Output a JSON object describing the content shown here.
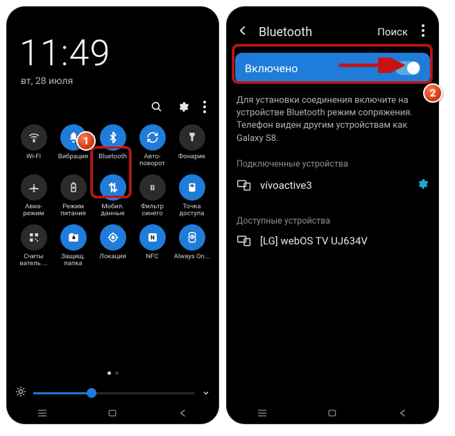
{
  "annotation": {
    "badge1": "1",
    "badge2": "2"
  },
  "phone1": {
    "clock": "11:49",
    "date": "вт, 28 июля",
    "tiles": [
      {
        "id": "wifi",
        "label": "Wi-Fi",
        "state": "off"
      },
      {
        "id": "vibration",
        "label": "Вибрация",
        "state": "on"
      },
      {
        "id": "bluetooth",
        "label": "Bluetooth",
        "state": "on"
      },
      {
        "id": "autorotate",
        "label": "Авто-\nповорот",
        "state": "on"
      },
      {
        "id": "flashlight",
        "label": "Фонарик",
        "state": "off"
      },
      {
        "id": "airplane",
        "label": "Авиа-\nрежим",
        "state": "off"
      },
      {
        "id": "powermode",
        "label": "Режим питания",
        "state": "off"
      },
      {
        "id": "mobiledata",
        "label": "Мобил. данные",
        "state": "on"
      },
      {
        "id": "bluefilter",
        "label": "Фильтр синего",
        "state": "off"
      },
      {
        "id": "hotspot",
        "label": "Точка доступа",
        "state": "on"
      },
      {
        "id": "qrscan",
        "label": "Считы ватель ...",
        "state": "off"
      },
      {
        "id": "secfolder",
        "label": "Защищ. папка",
        "state": "on"
      },
      {
        "id": "location",
        "label": "Локация",
        "state": "on"
      },
      {
        "id": "nfc",
        "label": "NFC",
        "state": "on"
      },
      {
        "id": "aod",
        "label": "Always On...",
        "state": "on"
      }
    ],
    "brightness_percent": 36
  },
  "phone2": {
    "header": {
      "title": "Bluetooth",
      "search": "Поиск"
    },
    "toggle_label": "Включено",
    "toggle_on": true,
    "description": "Для установки соединения включите на устройстве Bluetooth режим сопряжения. Телефон виден другим устройствам как Galaxy S8.",
    "connected_header": "Подключенные устройства",
    "available_header": "Доступные устройства",
    "connected": [
      {
        "name": "vívoactive3",
        "has_settings": true
      }
    ],
    "available": [
      {
        "name": "[LG] webOS TV UJ634V",
        "has_settings": false
      }
    ]
  }
}
